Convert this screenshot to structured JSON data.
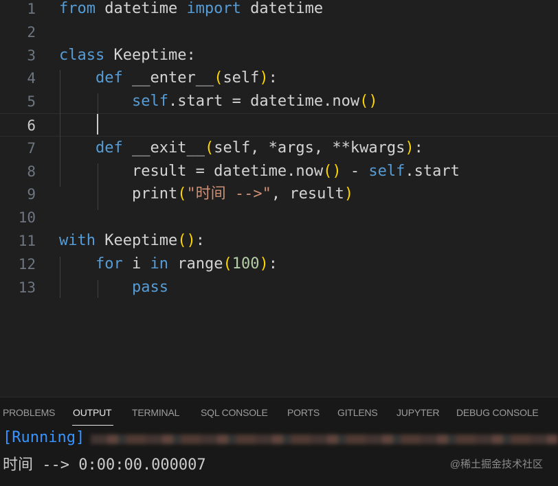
{
  "editor": {
    "line_numbers": [
      "1",
      "2",
      "3",
      "4",
      "5",
      "6",
      "7",
      "8",
      "9",
      "10",
      "11",
      "12",
      "13"
    ],
    "lines": [
      [
        {
          "t": "from",
          "c": "kw"
        },
        {
          "t": " datetime ",
          "c": "def"
        },
        {
          "t": "import",
          "c": "kw"
        },
        {
          "t": " datetime",
          "c": "def"
        }
      ],
      [],
      [
        {
          "t": "class",
          "c": "kw"
        },
        {
          "t": " Keeptime:",
          "c": "def"
        }
      ],
      [
        {
          "t": "    ",
          "c": "def"
        },
        {
          "t": "def",
          "c": "kw"
        },
        {
          "t": " __enter__",
          "c": "def"
        },
        {
          "t": "(",
          "c": "p1"
        },
        {
          "t": "self",
          "c": "def"
        },
        {
          "t": ")",
          "c": "p1"
        },
        {
          "t": ":",
          "c": "def"
        }
      ],
      [
        {
          "t": "        ",
          "c": "def"
        },
        {
          "t": "self",
          "c": "self"
        },
        {
          "t": ".start = datetime.now",
          "c": "def"
        },
        {
          "t": "()",
          "c": "p1"
        }
      ],
      [],
      [
        {
          "t": "    ",
          "c": "def"
        },
        {
          "t": "def",
          "c": "kw"
        },
        {
          "t": " __exit__",
          "c": "def"
        },
        {
          "t": "(",
          "c": "p1"
        },
        {
          "t": "self, *args, **kwargs",
          "c": "def"
        },
        {
          "t": ")",
          "c": "p1"
        },
        {
          "t": ":",
          "c": "def"
        }
      ],
      [
        {
          "t": "        result = datetime.now",
          "c": "def"
        },
        {
          "t": "()",
          "c": "p1"
        },
        {
          "t": " - ",
          "c": "def"
        },
        {
          "t": "self",
          "c": "self"
        },
        {
          "t": ".start",
          "c": "def"
        }
      ],
      [
        {
          "t": "        print",
          "c": "def"
        },
        {
          "t": "(",
          "c": "p1"
        },
        {
          "t": "\"时间 -->\"",
          "c": "str"
        },
        {
          "t": ", result",
          "c": "def"
        },
        {
          "t": ")",
          "c": "p1"
        }
      ],
      [],
      [
        {
          "t": "with",
          "c": "kw"
        },
        {
          "t": " Keeptime",
          "c": "def"
        },
        {
          "t": "()",
          "c": "p1"
        },
        {
          "t": ":",
          "c": "def"
        }
      ],
      [
        {
          "t": "    ",
          "c": "def"
        },
        {
          "t": "for",
          "c": "kw"
        },
        {
          "t": " i ",
          "c": "def"
        },
        {
          "t": "in",
          "c": "kw"
        },
        {
          "t": " range",
          "c": "def"
        },
        {
          "t": "(",
          "c": "p1"
        },
        {
          "t": "100",
          "c": "num"
        },
        {
          "t": ")",
          "c": "p1"
        },
        {
          "t": ":",
          "c": "def"
        }
      ],
      [
        {
          "t": "        ",
          "c": "def"
        },
        {
          "t": "pass",
          "c": "kw"
        }
      ]
    ],
    "active_line": 6
  },
  "panel": {
    "tabs": [
      "PROBLEMS",
      "OUTPUT",
      "TERMINAL",
      "SQL CONSOLE",
      "PORTS",
      "GITLENS",
      "JUPYTER",
      "DEBUG CONSOLE"
    ],
    "active_tab": "OUTPUT",
    "output": {
      "running_label": "[Running]",
      "result_line": "时间 --> 0:00:00.000007"
    }
  },
  "watermark": "@稀土掘金技术社区"
}
